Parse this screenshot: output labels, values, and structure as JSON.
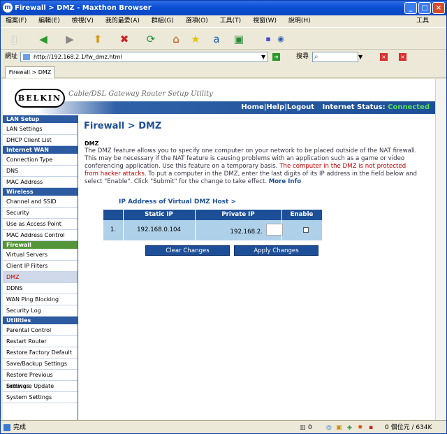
{
  "window": {
    "title": "Firewall > DMZ - Maxthon Browser"
  },
  "menu": [
    "檔案(F)",
    "編輯(E)",
    "檢視(V)",
    "我的最愛(A)",
    "群組(G)",
    "選項(O)",
    "工具(T)",
    "視窗(W)",
    "說明(H)"
  ],
  "menu_right": "工具",
  "addressbar": {
    "label": "網址",
    "url": "http://192.168.2.1/fw_dmz.html",
    "search_label": "搜尋"
  },
  "tabs": [
    {
      "label": "Firewall > DMZ"
    }
  ],
  "header": {
    "logo": "BELKIN",
    "tagline": "Cable/DSL Gateway Router Setup Utility",
    "links": {
      "home": "Home",
      "help": "Help",
      "logout": "Logout",
      "sep": "|"
    },
    "status_label": "Internet Status:",
    "status_value": "Connected",
    "status_color": "#58e05a"
  },
  "sidebar": [
    {
      "title": "LAN Setup",
      "items": [
        "LAN Settings",
        "DHCP Client List"
      ]
    },
    {
      "title": "Internet WAN",
      "items": [
        "Connection Type",
        "DNS",
        "MAC Address"
      ]
    },
    {
      "title": "Wireless",
      "items": [
        "Channel and SSID",
        "Security",
        "Use as Access Point",
        "MAC Address Control"
      ]
    },
    {
      "title": "Firewall",
      "items": [
        "Virtual Servers",
        "Client IP Filters",
        "DMZ",
        "DDNS",
        "WAN Ping Blocking",
        "Security Log"
      ]
    },
    {
      "title": "Utilities",
      "items": [
        "Parental Control",
        "Restart Router",
        "Restore Factory Default",
        "Save/Backup Settings",
        "Restore Previous Settings",
        "Firmware Update",
        "System Settings"
      ]
    }
  ],
  "main": {
    "title": "Firewall > DMZ",
    "section_label": "DMZ",
    "desc_1": "The DMZ feature allows you to specify one computer on your network to be placed outside of the NAT firewall. This may be necessary if the NAT feature is causing problems with an application such as a game or video conferencing application. Use this feature on a temporary basis. ",
    "desc_red": "The computer in the DMZ is not protected from hacker attacks.",
    "desc_2": " To put a computer in the DMZ, enter the last digits of its IP address in the field below and select \"Enable\". Click \"Submit\" for the change to take effect. ",
    "more_info": "More Info",
    "table_heading": "IP Address of Virtual DMZ Host >",
    "table": {
      "headers": [
        "Static IP",
        "Private IP",
        "Enable"
      ],
      "row": {
        "index": "1.",
        "static_ip": "192.168.0.104",
        "private_prefix": "192.168.2.",
        "private_last": "",
        "enabled": false
      }
    },
    "buttons": {
      "clear": "Clear Changes",
      "apply": "Apply Changes"
    }
  },
  "statusbar": {
    "left": "完成",
    "count": "0",
    "right": "0 個位元 / 634K"
  }
}
